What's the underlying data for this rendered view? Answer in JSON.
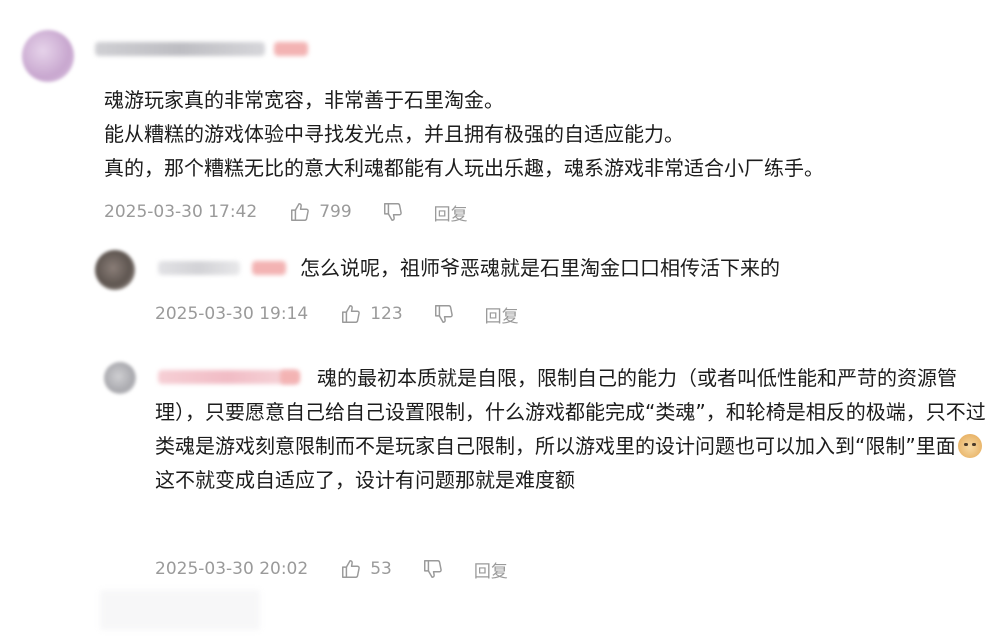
{
  "main_comment": {
    "lines": [
      "魂游玩家真的非常宽容，非常善于石里淘金。",
      "能从糟糕的游戏体验中寻找发光点，并且拥有极强的自适应能力。",
      "真的，那个糟糕无比的意大利魂都能有人玩出乐趣，魂系游戏非常适合小厂练手。"
    ],
    "time": "2025-03-30 17:42",
    "likes": "799",
    "reply_label": "回复"
  },
  "replies": [
    {
      "text": "怎么说呢，祖师爷恶魂就是石里淘金口口相传活下来的",
      "time": "2025-03-30 19:14",
      "likes": "123",
      "reply_label": "回复"
    },
    {
      "text_before_emoji": "魂的最初本质就是自限，限制自己的能力（或者叫低性能和严苛的资源管理），只要愿意自己给自己设置限制，什么游戏都能完成“类魂”，和轮椅是相反的极端，只不过类魂是游戏刻意限制而不是玩家自己限制，所以游戏里的设计问题也可以加入到“限制”里面",
      "emoji": "doge-emoji",
      "text_after_emoji": "这不就变成自适应了，设计有问题那就是难度额",
      "time": "2025-03-30 20:02",
      "likes": "53",
      "reply_label": "回复"
    }
  ],
  "colors": {
    "text": "#1c1c1c",
    "meta": "#9a9a9a",
    "name_tag": "#f3b3b3"
  },
  "icons": [
    "thumbs-up-icon",
    "thumbs-down-icon"
  ]
}
